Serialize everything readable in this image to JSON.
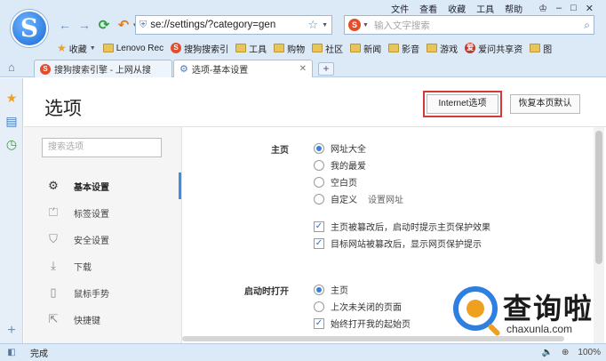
{
  "menubar": {
    "items": [
      "文件",
      "查看",
      "收藏",
      "工具",
      "帮助"
    ]
  },
  "toolbar": {
    "undo_caret": "▾"
  },
  "address": {
    "url": "se://settings/?category=gen"
  },
  "search": {
    "placeholder": "输入文字搜索"
  },
  "bookmarks": [
    {
      "label": "收藏",
      "icon": "star"
    },
    {
      "label": "Lenovo Rec",
      "icon": "folder"
    },
    {
      "label": "搜狗搜索引",
      "icon": "sogou"
    },
    {
      "label": "工具",
      "icon": "folder"
    },
    {
      "label": "购物",
      "icon": "folder"
    },
    {
      "label": "社区",
      "icon": "folder"
    },
    {
      "label": "新闻",
      "icon": "folder"
    },
    {
      "label": "影音",
      "icon": "folder"
    },
    {
      "label": "游戏",
      "icon": "folder"
    },
    {
      "label": "爱问共享资",
      "icon": "ishare"
    },
    {
      "label": "图",
      "icon": "folder"
    }
  ],
  "tabs": [
    {
      "title": "搜狗搜索引擎 - 上网从搜",
      "active": false
    },
    {
      "title": "选项-基本设置",
      "active": true
    }
  ],
  "page": {
    "title": "选项",
    "internet_button": "Internet选项",
    "reset_button": "恢复本页默认",
    "search_placeholder": "搜索选项"
  },
  "nav": [
    {
      "label": "基本设置",
      "icon": "gear",
      "active": true
    },
    {
      "label": "标签设置",
      "icon": "tab",
      "active": false
    },
    {
      "label": "安全设置",
      "icon": "shield",
      "active": false
    },
    {
      "label": "下载",
      "icon": "download",
      "active": false
    },
    {
      "label": "鼠标手势",
      "icon": "mouse",
      "active": false
    },
    {
      "label": "快捷键",
      "icon": "shortcut",
      "active": false
    }
  ],
  "homepage": {
    "label": "主页",
    "options": [
      "网址大全",
      "我的最爱",
      "空白页",
      "自定义"
    ],
    "selected": 0,
    "custom_link": "设置网址",
    "checks": [
      "主页被篡改后，启动时提示主页保护效果",
      "目标网站被篡改后，显示网页保护提示"
    ]
  },
  "startup": {
    "label": "启动时打开",
    "options": [
      "主页",
      "上次未关闭的页面"
    ],
    "selected": 0,
    "check": "始终打开我的起始页"
  },
  "watermark": {
    "name": "查询啦",
    "domain": "chaxunla.com"
  },
  "status": {
    "text": "完成",
    "zoom": "100%"
  },
  "colors": {
    "accent": "#3a8ee6",
    "highlight_outline": "#d43a3a",
    "chrome": "#dce9f7"
  }
}
